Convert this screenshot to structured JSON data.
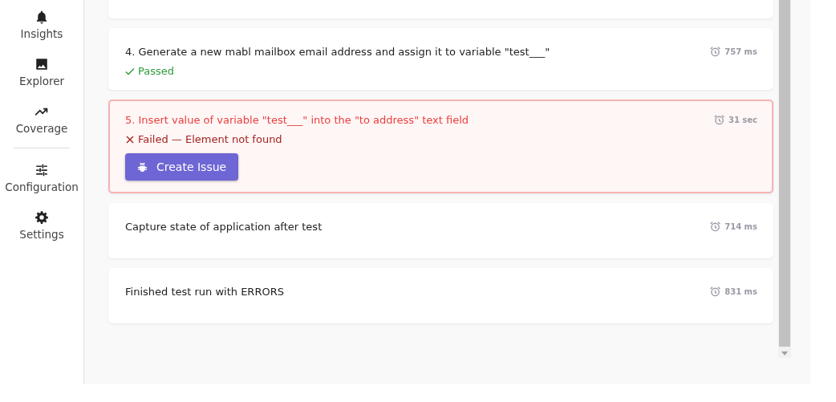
{
  "sidebar": {
    "groups": [
      [
        {
          "label": "Insights"
        },
        {
          "label": "Explorer"
        },
        {
          "label": "Coverage"
        }
      ],
      [
        {
          "label": "Configuration"
        },
        {
          "label": "Settings"
        }
      ]
    ]
  },
  "steps": [
    {
      "kind": "passed",
      "title": "4. Generate a new mabl mailbox email address and assign it to variable \"test___\"",
      "duration": "757 ms",
      "result": "Passed"
    },
    {
      "kind": "failed",
      "title": "5. Insert value of variable \"test___\" into the \"to address\" text field",
      "duration": "31 sec",
      "result": "Failed — Element not found",
      "action": "Create Issue"
    },
    {
      "kind": "plain",
      "title": "Capture state of application after test",
      "duration": "714 ms"
    },
    {
      "kind": "plain",
      "title": "Finished test run with ERRORS",
      "duration": "831 ms"
    }
  ]
}
